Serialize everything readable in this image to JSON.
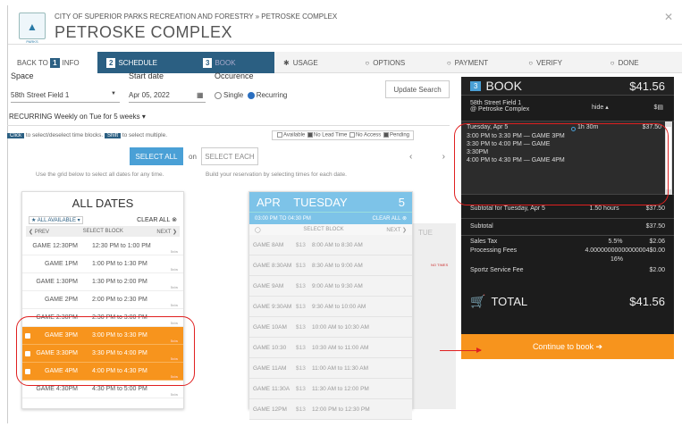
{
  "header": {
    "breadcrumb": "CITY OF SUPERIOR PARKS RECREATION AND FORESTRY  »  PETROSKE COMPLEX",
    "title": "PETROSKE COMPLEX",
    "logo_text": "PARKS"
  },
  "steps": {
    "back": "BACK TO",
    "info_num": "1",
    "info": "INFO",
    "sched_num": "2",
    "schedule": "SCHEDULE",
    "book_num": "3",
    "book": "BOOK",
    "usage": "USAGE",
    "options": "OPTIONS",
    "payment": "PAYMENT",
    "verify": "VERIFY",
    "done": "DONE"
  },
  "filters": {
    "space_label": "Space",
    "space_value": "58th Street Field 1",
    "start_label": "Start date",
    "start_value": "Apr 05, 2022",
    "occ_label": "Occurence",
    "single": "Single",
    "recurring": "Recurring",
    "update": "Update Search"
  },
  "recurring": "RECURRING Weekly on Tue for 5 weeks",
  "legend": {
    "click": "Click",
    "click_text": "to select/deselect time blocks.",
    "shift": "Shift",
    "shift_text": "to select multiple.",
    "available": "Available",
    "no_lead": "No Lead Time",
    "no_access": "No Access",
    "pending": "Pending"
  },
  "select": {
    "all": "SELECT ALL",
    "on": "on",
    "each": "SELECT EACH"
  },
  "hints": {
    "left": "Use the grid below to select all dates for any time.",
    "right": "Build your reservation by selecting times for each date."
  },
  "alldates": {
    "title": "ALL DATES",
    "all_available": "ALL AVAILABLE",
    "clear": "CLEAR ALL",
    "prev": "PREV",
    "select_block": "SELECT BLOCK",
    "next": "NEXT",
    "rows": [
      {
        "game": "GAME 12:30PM",
        "time": "12:30 PM to 1:00 PM",
        "tw": "5x/w"
      },
      {
        "game": "GAME 1PM",
        "time": "1:00 PM to 1:30 PM",
        "tw": "5x/w"
      },
      {
        "game": "GAME 1:30PM",
        "time": "1:30 PM to 2:00 PM",
        "tw": "5x/w"
      },
      {
        "game": "GAME 2PM",
        "time": "2:00 PM to 2:30 PM",
        "tw": "5x/w"
      },
      {
        "game": "GAME 2:30PM",
        "time": "2:30 PM to 3:00 PM",
        "tw": "5x/w"
      },
      {
        "game": "GAME 3PM",
        "time": "3:00 PM to 3:30 PM",
        "tw": "5x/w"
      },
      {
        "game": "GAME 3:30PM",
        "time": "3:30 PM to 4:00 PM",
        "tw": "5x/w"
      },
      {
        "game": "GAME 4PM",
        "time": "4:00 PM to 4:30 PM",
        "tw": "5x/w"
      },
      {
        "game": "GAME 4:30PM",
        "time": "4:30 PM to 5:00 PM",
        "tw": "5x/w"
      }
    ]
  },
  "apr": {
    "month": "APR",
    "weekday": "TUESDAY",
    "day": "5",
    "range": "03:00 PM TO 04:30 PM",
    "clear": "CLEAR ALL",
    "select_block": "SELECT BLOCK",
    "next": "NEXT",
    "tue": "TUE",
    "no_times": "NO TIMES",
    "rows": [
      {
        "game": "GAME 8AM",
        "price": "$13",
        "time": "8:00 AM to 8:30 AM"
      },
      {
        "game": "GAME 8:30AM",
        "price": "$13",
        "time": "8:30 AM to 9:00 AM"
      },
      {
        "game": "GAME 9AM",
        "price": "$13",
        "time": "9:00 AM to 9:30 AM"
      },
      {
        "game": "GAME 9:30AM",
        "price": "$13",
        "time": "9:30 AM to 10:00 AM"
      },
      {
        "game": "GAME 10AM",
        "price": "$13",
        "time": "10:00 AM to 10:30 AM"
      },
      {
        "game": "GAME 10:30",
        "price": "$13",
        "time": "10:30 AM to 11:00 AM"
      },
      {
        "game": "GAME 11AM",
        "price": "$13",
        "time": "11:00 AM to 11:30 AM"
      },
      {
        "game": "GAME 11:30A",
        "price": "$13",
        "time": "11:30 AM to 12:00 PM"
      },
      {
        "game": "GAME 12PM",
        "price": "$13",
        "time": "12:00 PM to 12:30 PM"
      }
    ]
  },
  "book": {
    "num": "3",
    "title": "BOOK",
    "amount": "$41.56",
    "site": "58th Street Field 1",
    "site2": "@ Petroske Complex",
    "hide": "hide",
    "site_amount": "$",
    "date": "Tuesday, Apr 5",
    "duration": "1h 30m",
    "date_amount": "$37.50",
    "slots": [
      "3:00 PM to 3:30 PM — GAME 3PM",
      "3:30 PM to 4:00 PM — GAME 3:30PM",
      "4:00 PM to 4:30 PM — GAME 4PM"
    ],
    "subtotal_label": "Subtotal for Tuesday, Apr 5",
    "subtotal_hours": "1.50 hours",
    "subtotal_amount": "$37.50",
    "sub_label": "Subtotal",
    "sub_amount": "$37.50",
    "tax_label": "Sales Tax",
    "tax_pct": "5.5%",
    "tax_amount": "$2.06",
    "proc_label": "Processing Fees",
    "proc_pct": "4.00000000000000004",
    "proc_pct2": "16%",
    "proc_amount": "$0.00",
    "sportz_label": "Sportz Service Fee",
    "sportz_amount": "$2.00",
    "total_label": "TOTAL",
    "total_amount": "$41.56",
    "continue": "Continue to book"
  }
}
